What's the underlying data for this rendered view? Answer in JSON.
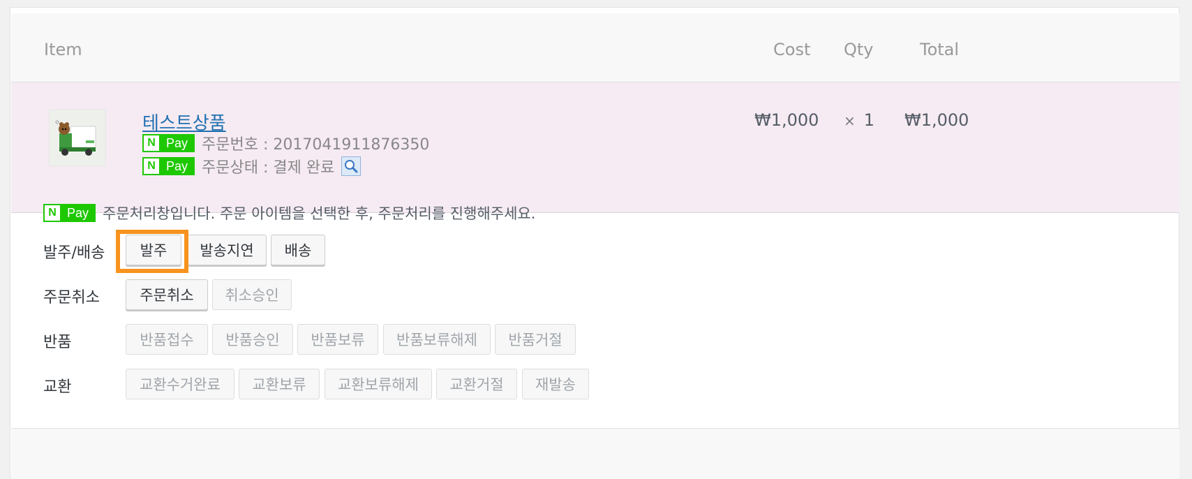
{
  "header": {
    "item": "Item",
    "cost": "Cost",
    "qty": "Qty",
    "total": "Total"
  },
  "item": {
    "name": "테스트상품",
    "order_number_label": "주문번호 : 2017041911876350",
    "order_status_label": "주문상태 : 결제 완료",
    "cost": "₩1,000",
    "qty_prefix": "×",
    "qty": "1",
    "total": "₩1,000"
  },
  "npay": {
    "n": "N",
    "pay": "Pay"
  },
  "notice": "주문처리창입니다. 주문 아이템을 선택한 후, 주문처리를 진행해주세요.",
  "groups": [
    {
      "label": "발주/배송",
      "buttons": [
        "발주",
        "발송지연",
        "배송"
      ]
    },
    {
      "label": "주문취소",
      "buttons": [
        "주문취소",
        "취소승인"
      ]
    },
    {
      "label": "반품",
      "buttons": [
        "반품접수",
        "반품승인",
        "반품보류",
        "반품보류해제",
        "반품거절"
      ]
    },
    {
      "label": "교환",
      "buttons": [
        "교환수거완료",
        "교환보류",
        "교환보류해제",
        "교환거절",
        "재발송"
      ]
    }
  ],
  "colors": {
    "npay_green": "#1ec800",
    "highlight": "#f7931e",
    "item_row_bg": "#f6ebf3",
    "link": "#2271b1"
  },
  "icons": {
    "search": "search-icon",
    "thumbnail": "truck-character-thumbnail"
  }
}
